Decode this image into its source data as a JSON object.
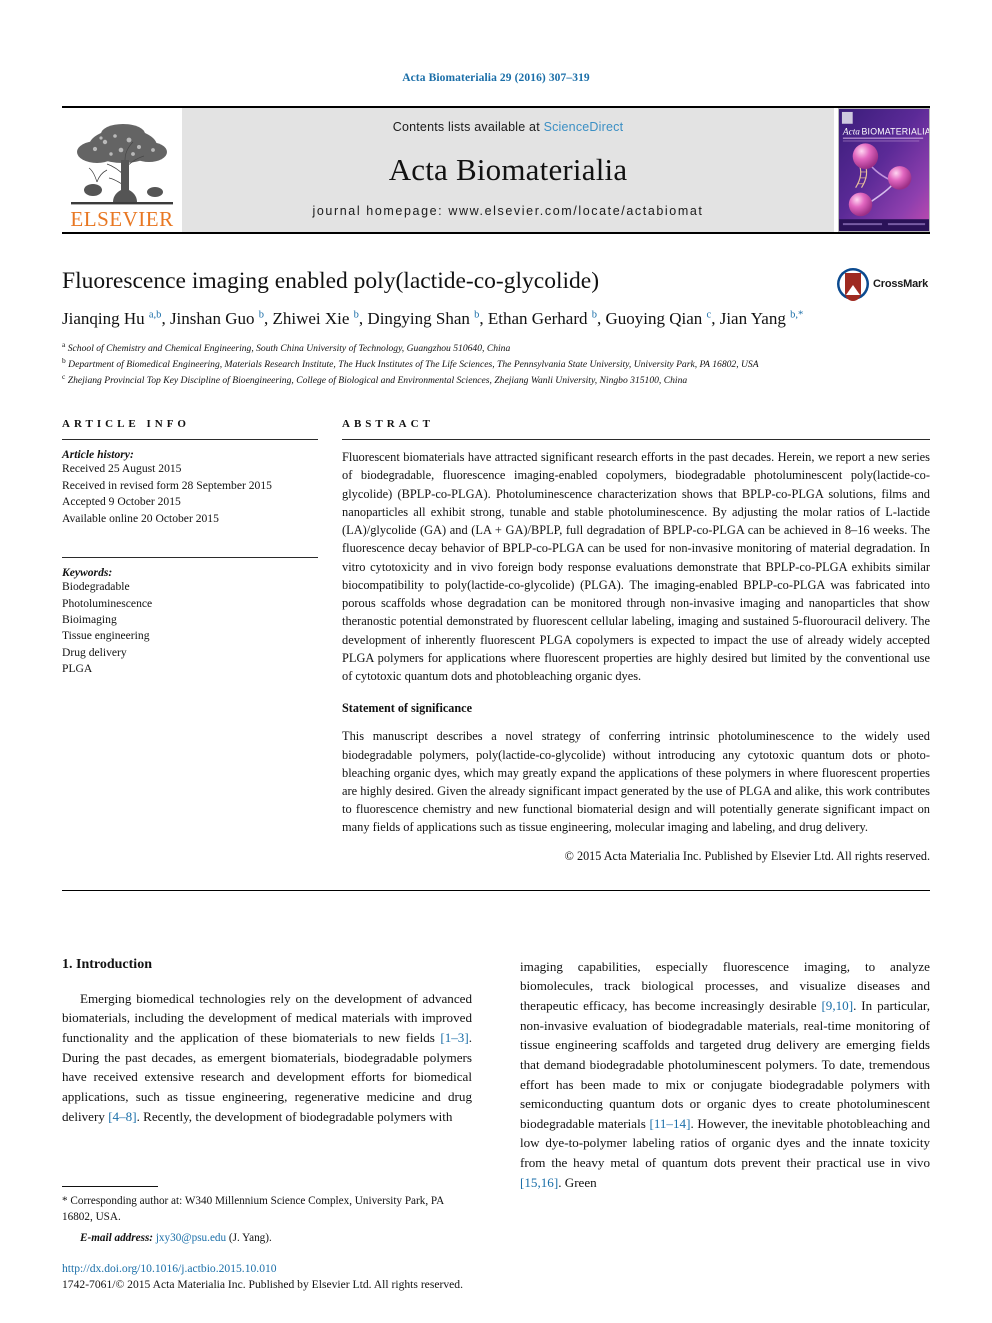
{
  "running_head": "Acta Biomaterialia 29 (2016) 307–319",
  "masthead": {
    "publisher_wordmark": "ELSEVIER",
    "contents_prefix": "Contents lists available at",
    "contents_link": "ScienceDirect",
    "journal_name": "Acta Biomaterialia",
    "homepage": "journal homepage: www.elsevier.com/locate/actabiomat",
    "cover_title": "Acta BIOMATERIALIA",
    "cover_subtitle": "THE JOURNAL OF THE ACTA MATERIALIA SOCIETY"
  },
  "article": {
    "title": "Fluorescence imaging enabled poly(lactide-co-glycolide)",
    "crossmark_label": "CrossMark",
    "authors_html": "Jianqing Hu <sup>a,b</sup>, Jinshan Guo <sup>b</sup>, Zhiwei Xie <sup>b</sup>, Dingying Shan <sup>b</sup>, Ethan Gerhard <sup>b</sup>, Guoying Qian <sup>c</sup>, Jian Yang <sup>b,*</sup>",
    "affiliations": [
      "<sup>a</sup> School of Chemistry and Chemical Engineering, South China University of Technology, Guangzhou 510640, China",
      "<sup>b</sup> Department of Biomedical Engineering, Materials Research Institute, The Huck Institutes of The Life Sciences, The Pennsylvania State University, University Park, PA 16802, USA",
      "<sup>c</sup> Zhejiang Provincial Top Key Discipline of Bioengineering, College of Biological and Environmental Sciences, Zhejiang Wanli University, Ningbo 315100, China"
    ]
  },
  "article_info": {
    "label": "ARTICLE INFO",
    "history_title": "Article history:",
    "history": [
      "Received 25 August 2015",
      "Received in revised form 28 September 2015",
      "Accepted 9 October 2015",
      "Available online 20 October 2015"
    ],
    "keywords_title": "Keywords:",
    "keywords": [
      "Biodegradable",
      "Photoluminescence",
      "Bioimaging",
      "Tissue engineering",
      "Drug delivery",
      "PLGA"
    ]
  },
  "abstract": {
    "label": "ABSTRACT",
    "paragraph": "Fluorescent biomaterials have attracted significant research efforts in the past decades. Herein, we report a new series of biodegradable, fluorescence imaging-enabled copolymers, biodegradable photoluminescent poly(lactide-co-glycolide) (BPLP-co-PLGA). Photoluminescence characterization shows that BPLP-co-PLGA solutions, films and nanoparticles all exhibit strong, tunable and stable photoluminescence. By adjusting the molar ratios of L-lactide (LA)/glycolide (GA) and (LA + GA)/BPLP, full degradation of BPLP-co-PLGA can be achieved in 8–16 weeks. The fluorescence decay behavior of BPLP-co-PLGA can be used for non-invasive monitoring of material degradation. In vitro cytotoxicity and in vivo foreign body response evaluations demonstrate that BPLP-co-PLGA exhibits similar biocompatibility to poly(lactide-co-glycolide) (PLGA). The imaging-enabled BPLP-co-PLGA was fabricated into porous scaffolds whose degradation can be monitored through non-invasive imaging and nanoparticles that show theranostic potential demonstrated by fluorescent cellular labeling, imaging and sustained 5-fluorouracil delivery. The development of inherently fluorescent PLGA copolymers is expected to impact the use of already widely accepted PLGA polymers for applications where fluorescent properties are highly desired but limited by the conventional use of cytotoxic quantum dots and photobleaching organic dyes.",
    "significance_heading": "Statement of significance",
    "significance": "This manuscript describes a novel strategy of conferring intrinsic photoluminescence to the widely used biodegradable polymers, poly(lactide-co-glycolide) without introducing any cytotoxic quantum dots or photo-bleaching organic dyes, which may greatly expand the applications of these polymers in where fluorescent properties are highly desired. Given the already significant impact generated by the use of PLGA and alike, this work contributes to fluorescence chemistry and new functional biomaterial design and will potentially generate significant impact on many fields of applications such as tissue engineering, molecular imaging and labeling, and drug delivery.",
    "copyright": "© 2015 Acta Materialia Inc. Published by Elsevier Ltd. All rights reserved."
  },
  "introduction": {
    "heading": "1. Introduction",
    "left_html": "Emerging biomedical technologies rely on the development of advanced biomaterials, including the development of medical materials with improved functionality and the application of these biomaterials to new fields <span class=\"ref\">[1–3]</span>. During the past decades, as emergent biomaterials, biodegradable polymers have received extensive research and development efforts for biomedical applications, such as tissue engineering, regenerative medicine and drug delivery <span class=\"ref\">[4–8]</span>. Recently, the development of biodegradable polymers with",
    "right_html": "imaging capabilities, especially fluorescence imaging, to analyze biomolecules, track biological processes, and visualize diseases and therapeutic efficacy, has become increasingly desirable <span class=\"ref\">[9,10]</span>. In particular, non-invasive evaluation of biodegradable materials, real-time monitoring of tissue engineering scaffolds and targeted drug delivery are emerging fields that demand biodegradable photoluminescent polymers. To date, tremendous effort has been made to mix or conjugate biodegradable polymers with semiconducting quantum dots or organic dyes to create photoluminescent biodegradable materials <span class=\"ref\">[11–14]</span>. However, the inevitable photobleaching and low dye-to-polymer labeling ratios of organic dyes and the innate toxicity from the heavy metal of quantum dots prevent their practical use in vivo <span class=\"ref\">[15,16]</span>. Green"
  },
  "footnotes": {
    "corresponding_html": "<span class=\"star\">*</span> Corresponding author at: W340 Millennium Science Complex, University Park, PA 16802, USA.",
    "email_label": "E-mail address:",
    "email": "jxy30@psu.edu",
    "email_owner": "(J. Yang).",
    "doi": "http://dx.doi.org/10.1016/j.actbio.2015.10.010",
    "issn_line": "1742-7061/© 2015 Acta Materialia Inc. Published by Elsevier Ltd. All rights reserved."
  },
  "colors": {
    "link_blue": "#1a6ea8",
    "sciencedirect_blue": "#3b8fc4",
    "elsevier_orange": "#E87722",
    "band_gray": "#e3e3e3"
  }
}
